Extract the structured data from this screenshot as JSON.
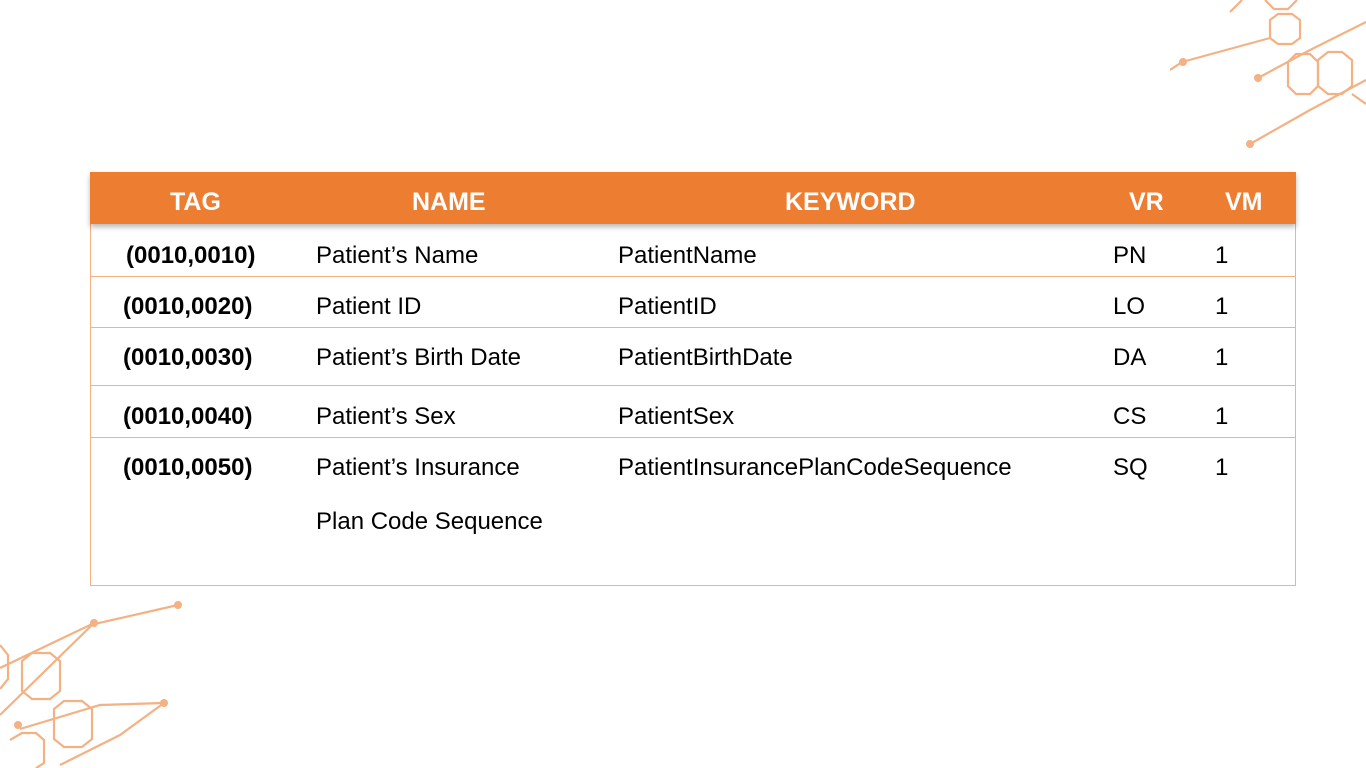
{
  "table": {
    "columns": [
      "TAG",
      "NAME",
      "KEYWORD",
      "VR",
      "VM"
    ],
    "rows": [
      {
        "tag": "(0010,0010)",
        "name": [
          "Patient’s Name"
        ],
        "keyword": "PatientName",
        "vr": "PN",
        "vm": "1"
      },
      {
        "tag": "(0010,0020)",
        "name": [
          "Patient ID"
        ],
        "keyword": "PatientID",
        "vr": "LO",
        "vm": "1"
      },
      {
        "tag": "(0010,0030)",
        "name": [
          "Patient’s Birth Date"
        ],
        "keyword": "PatientBirthDate",
        "vr": "DA",
        "vm": "1"
      },
      {
        "tag": "(0010,0040)",
        "name": [
          "Patient’s Sex"
        ],
        "keyword": "PatientSex",
        "vr": "CS",
        "vm": "1"
      },
      {
        "tag": "(0010,0050)",
        "name": [
          "Patient’s Insurance",
          "Plan Code Sequence"
        ],
        "keyword": "PatientInsurancePlanCodeSequence",
        "vr": "SQ",
        "vm": "1"
      }
    ]
  },
  "colors": {
    "header_bg": "#ed7d31",
    "header_text": "#ffffff",
    "row_divider": "#f4b183",
    "decoration": "#f4b183"
  }
}
